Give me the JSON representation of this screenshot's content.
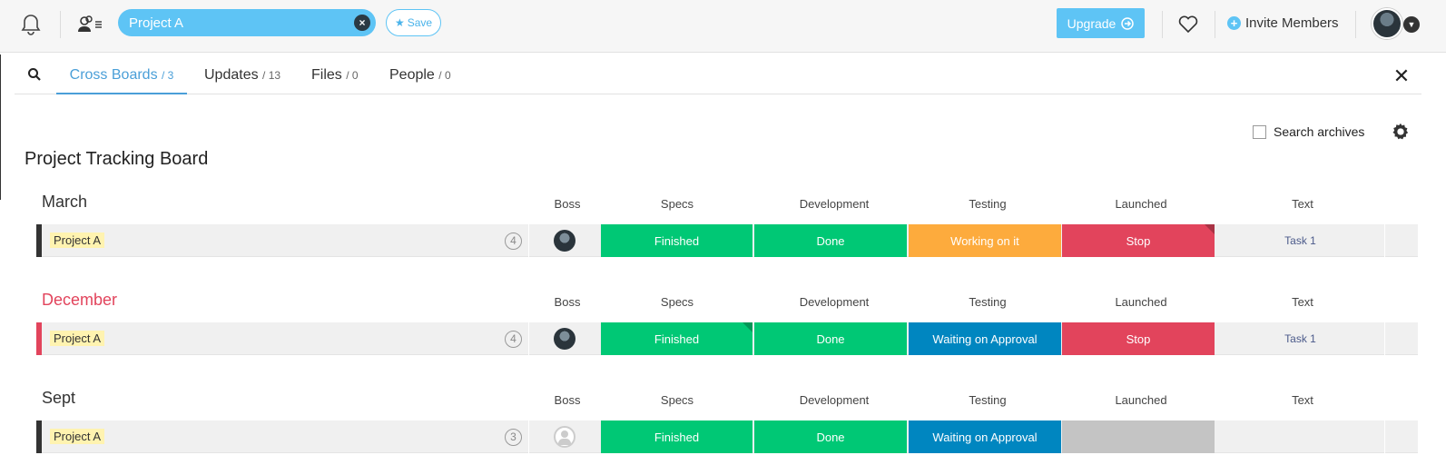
{
  "search": {
    "value": "Project A",
    "save_label": "Save"
  },
  "topbar": {
    "upgrade_label": "Upgrade",
    "invite_label": "Invite Members"
  },
  "tabs": [
    {
      "label": "Cross Boards",
      "count": "/ 3",
      "active": true
    },
    {
      "label": "Updates",
      "count": "/ 13",
      "active": false
    },
    {
      "label": "Files",
      "count": "/ 0",
      "active": false
    },
    {
      "label": "People",
      "count": "/ 0",
      "active": false
    }
  ],
  "archive_label": "Search archives",
  "board_title": "Project Tracking Board",
  "columns": [
    "Boss",
    "Specs",
    "Development",
    "Testing",
    "Launched",
    "Text"
  ],
  "colors": {
    "green": "#00c875",
    "orange": "#fdab3d",
    "red": "#e2445c",
    "blue": "#0086c0",
    "grey": "#c4c4c4",
    "accent": "#5ec4f5"
  },
  "groups": [
    {
      "name": "March",
      "name_color": "#333333",
      "bar_color": "#333333",
      "item": "Project A",
      "updates": "4",
      "boss": "photo",
      "specs": "Finished",
      "development": "Done",
      "testing": "Working on it",
      "launched": "Stop",
      "text": "Task 1",
      "specs_color": "#00c875",
      "development_color": "#00c875",
      "testing_color": "#fdab3d",
      "launched_color": "#e2445c"
    },
    {
      "name": "December",
      "name_color": "#e2445c",
      "bar_color": "#e2445c",
      "item": "Project A",
      "updates": "4",
      "boss": "photo",
      "specs": "Finished",
      "development": "Done",
      "testing": "Waiting on Approval",
      "launched": "Stop",
      "text": "Task 1",
      "specs_color": "#00c875",
      "development_color": "#00c875",
      "testing_color": "#0086c0",
      "launched_color": "#e2445c"
    },
    {
      "name": "Sept",
      "name_color": "#333333",
      "bar_color": "#333333",
      "item": "Project A",
      "updates": "3",
      "boss": "empty",
      "specs": "Finished",
      "development": "Done",
      "testing": "Waiting on Approval",
      "launched": "",
      "text": "",
      "specs_color": "#00c875",
      "development_color": "#00c875",
      "testing_color": "#0086c0",
      "launched_color": "#c4c4c4"
    }
  ]
}
